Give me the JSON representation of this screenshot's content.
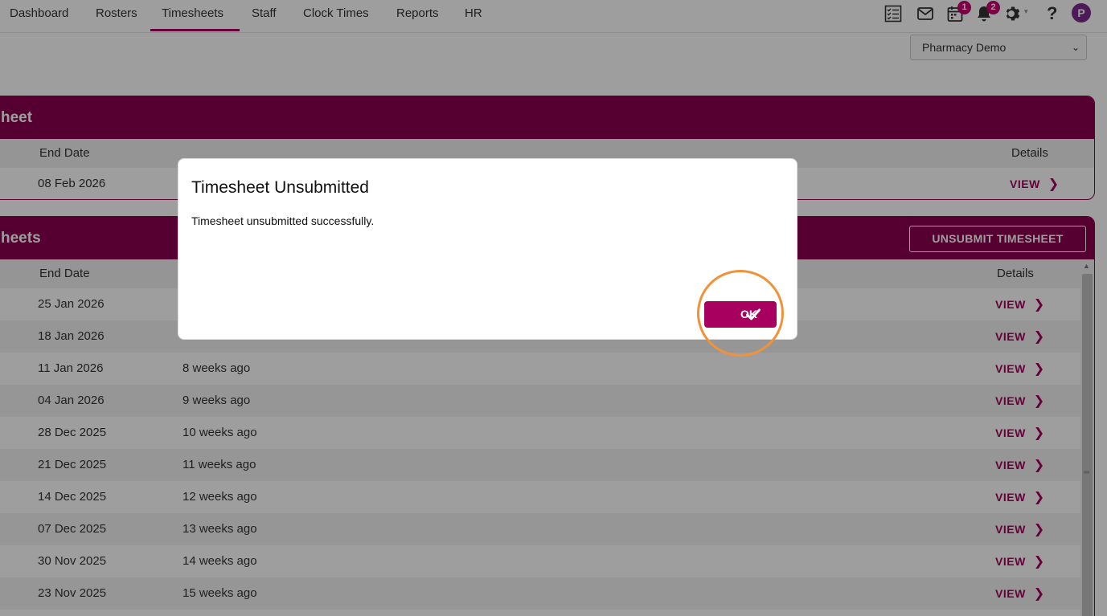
{
  "nav": {
    "items": [
      {
        "label": "Dashboard"
      },
      {
        "label": "Rosters"
      },
      {
        "label": "Timesheets",
        "active": true
      },
      {
        "label": "Staff"
      },
      {
        "label": "Clock Times"
      },
      {
        "label": "Reports"
      },
      {
        "label": "HR"
      }
    ],
    "icons": [
      "checklist-icon",
      "mail-icon",
      "calendar-icon",
      "bell-icon",
      "gear-icon",
      "help-icon"
    ],
    "calendar_badge": "1",
    "bell_badge": "2",
    "avatar_initial": "P"
  },
  "org_select": {
    "value": "Pharmacy Demo"
  },
  "current_panel": {
    "title": "heet",
    "columns": {
      "end_date": "End Date",
      "details": "Details"
    },
    "rows": [
      {
        "end_date": "08 Feb 2026",
        "view": "VIEW"
      }
    ]
  },
  "history_panel": {
    "title": "heets",
    "unsubmit_label": "UNSUBMIT TIMESHEET",
    "columns": {
      "end_date": "End Date",
      "details": "Details"
    },
    "rows": [
      {
        "end_date": "25 Jan 2026",
        "ago": "",
        "view": "VIEW"
      },
      {
        "end_date": "18 Jan 2026",
        "ago": "",
        "view": "VIEW"
      },
      {
        "end_date": "11 Jan 2026",
        "ago": "8 weeks ago",
        "view": "VIEW"
      },
      {
        "end_date": "04 Jan 2026",
        "ago": "9 weeks ago",
        "view": "VIEW"
      },
      {
        "end_date": "28 Dec 2025",
        "ago": "10 weeks ago",
        "view": "VIEW"
      },
      {
        "end_date": "21 Dec 2025",
        "ago": "11 weeks ago",
        "view": "VIEW"
      },
      {
        "end_date": "14 Dec 2025",
        "ago": "12 weeks ago",
        "view": "VIEW"
      },
      {
        "end_date": "07 Dec 2025",
        "ago": "13 weeks ago",
        "view": "VIEW"
      },
      {
        "end_date": "30 Nov 2025",
        "ago": "14 weeks ago",
        "view": "VIEW"
      },
      {
        "end_date": "23 Nov 2025",
        "ago": "15 weeks ago",
        "view": "VIEW"
      }
    ]
  },
  "modal": {
    "title": "Timesheet Unsubmitted",
    "message": "Timesheet unsubmitted successfully.",
    "ok_label": "OK"
  },
  "colors": {
    "brand": "#8a0050",
    "accent": "#a8005f",
    "highlight": "#f0923a"
  }
}
